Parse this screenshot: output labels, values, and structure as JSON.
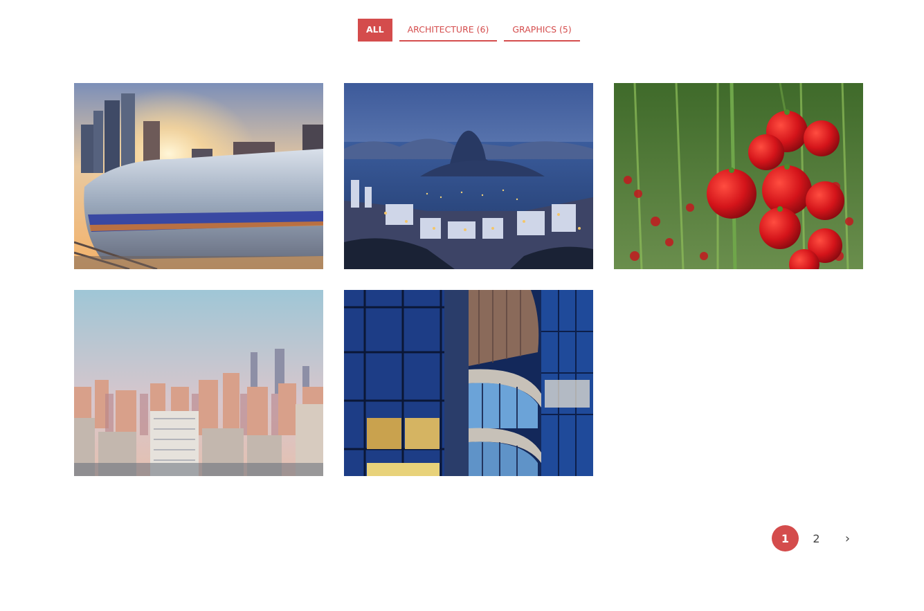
{
  "filters": [
    {
      "label": "ALL",
      "active": true
    },
    {
      "label": "ARCHITECTURE (6)",
      "active": false
    },
    {
      "label": "GRAPHICS (5)",
      "active": false
    }
  ],
  "gallery": [
    {
      "subject": "speeding train through city at sunset"
    },
    {
      "subject": "coastal city bay at dusk with mountain"
    },
    {
      "subject": "red tomatoes on vine in greenhouse"
    },
    {
      "subject": "city skyline of high-rise buildings"
    },
    {
      "subject": "glass office building facade at night"
    }
  ],
  "pagination": {
    "pages": [
      "1",
      "2"
    ],
    "current": "1",
    "next_label": "›"
  },
  "colors": {
    "accent": "#d44c4c",
    "page_text": "#444444",
    "background": "#ffffff"
  }
}
